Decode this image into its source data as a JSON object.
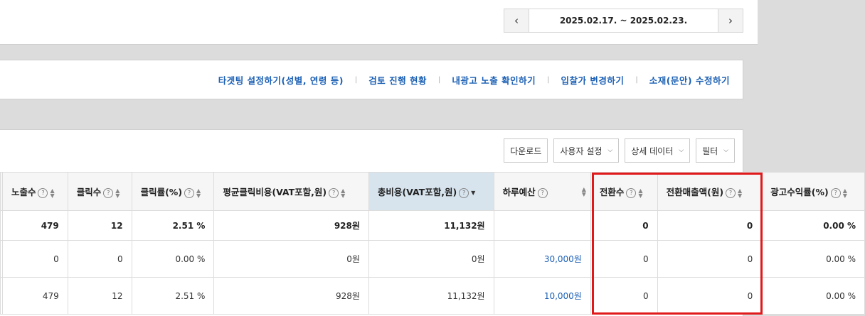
{
  "date_range": {
    "text": "2025.02.17. ~ 2025.02.23.",
    "prev_label": "‹",
    "next_label": "›"
  },
  "links": [
    "타겟팅 설정하기(성별, 연령 등)",
    "검토 진행 현황",
    "내광고 노출 확인하기",
    "입찰가 변경하기",
    "소재(문안) 수정하기"
  ],
  "link_separator": "|",
  "toolbar": {
    "download": "다운로드",
    "user_settings": "사용자 설정",
    "detail_data": "상세 데이터",
    "filter": "필터"
  },
  "table": {
    "headers": [
      "노출수",
      "클릭수",
      "클릭률(%)",
      "평균클릭비용(VAT포함,원)",
      "총비용(VAT포함,원)",
      "하루예산",
      "전환수",
      "전환매출액(원)",
      "광고수익률(%)"
    ],
    "sum_row": [
      "479",
      "12",
      "2.51 %",
      "928원",
      "11,132원",
      "",
      "0",
      "0",
      "0.00 %"
    ],
    "rows": [
      [
        "0",
        "0",
        "0.00 %",
        "0원",
        "0원",
        "30,000원",
        "0",
        "0",
        "0.00 %"
      ],
      [
        "479",
        "12",
        "2.51 %",
        "928원",
        "11,132원",
        "10,000원",
        "0",
        "0",
        "0.00 %"
      ]
    ]
  },
  "help_glyph": "?",
  "colors": {
    "link": "#1a5fb4",
    "highlight": "#e0191b",
    "sorted_header": "#d7e4ee"
  }
}
